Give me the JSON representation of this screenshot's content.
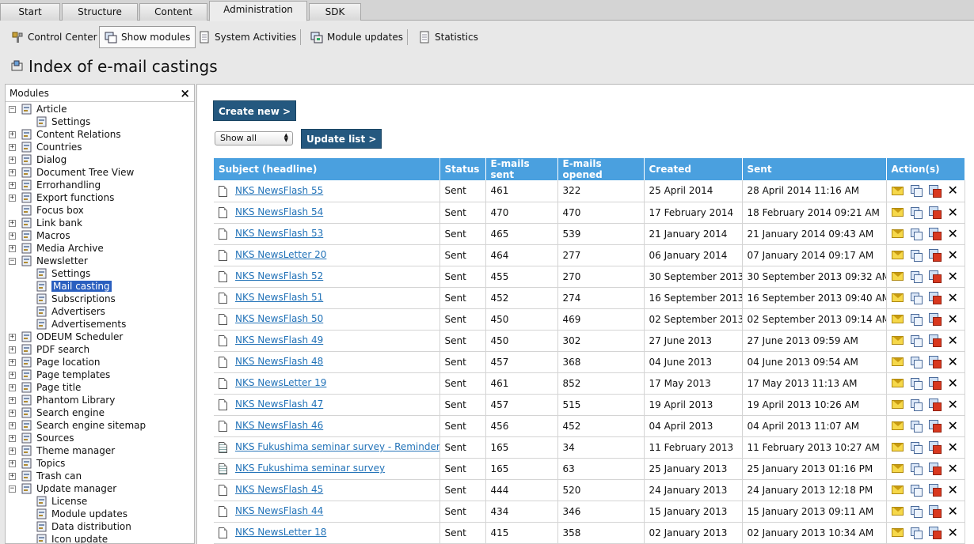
{
  "tabs": [
    "Start",
    "Structure",
    "Content",
    "Administration",
    "SDK"
  ],
  "toolbar": {
    "control_center": "Control Center",
    "show_modules": "Show modules",
    "system_activities": "System Activities",
    "module_updates": "Module updates",
    "statistics": "Statistics"
  },
  "page_title": "Index of e-mail castings",
  "sidebar": {
    "title": "Modules",
    "close": "×",
    "tree": [
      {
        "label": "Article",
        "toggle": "−",
        "level": 0,
        "icon": "article-icon"
      },
      {
        "label": "Settings",
        "toggle": "",
        "level": 1,
        "icon": "settings-icon"
      },
      {
        "label": "Content Relations",
        "toggle": "+",
        "level": 0,
        "icon": "relations-icon"
      },
      {
        "label": "Countries",
        "toggle": "+",
        "level": 0,
        "icon": "globe-icon"
      },
      {
        "label": "Dialog",
        "toggle": "+",
        "level": 0,
        "icon": "dialog-icon"
      },
      {
        "label": "Document Tree View",
        "toggle": "+",
        "level": 0,
        "icon": "tree-view-icon"
      },
      {
        "label": "Errorhandling",
        "toggle": "+",
        "level": 0,
        "icon": "error-icon"
      },
      {
        "label": "Export functions",
        "toggle": "+",
        "level": 0,
        "icon": "export-icon"
      },
      {
        "label": "Focus box",
        "toggle": "",
        "level": 0,
        "icon": "focus-box-icon"
      },
      {
        "label": "Link bank",
        "toggle": "+",
        "level": 0,
        "icon": "link-icon"
      },
      {
        "label": "Macros",
        "toggle": "+",
        "level": 0,
        "icon": "macros-icon"
      },
      {
        "label": "Media Archive",
        "toggle": "+",
        "level": 0,
        "icon": "folder-icon"
      },
      {
        "label": "Newsletter",
        "toggle": "−",
        "level": 0,
        "icon": "newsletter-icon"
      },
      {
        "label": "Settings",
        "toggle": "",
        "level": 1,
        "icon": "settings-icon"
      },
      {
        "label": "Mail casting",
        "toggle": "",
        "level": 1,
        "icon": "mail-casting-icon",
        "selected": true
      },
      {
        "label": "Subscriptions",
        "toggle": "",
        "level": 1,
        "icon": "subscriptions-icon"
      },
      {
        "label": "Advertisers",
        "toggle": "",
        "level": 1,
        "icon": "advertisers-icon"
      },
      {
        "label": "Advertisements",
        "toggle": "",
        "level": 1,
        "icon": "advertisements-icon"
      },
      {
        "label": "ODEUM Scheduler",
        "toggle": "+",
        "level": 0,
        "icon": "scheduler-icon"
      },
      {
        "label": "PDF search",
        "toggle": "+",
        "level": 0,
        "icon": "pdf-search-icon"
      },
      {
        "label": "Page location",
        "toggle": "+",
        "level": 0,
        "icon": "page-location-icon"
      },
      {
        "label": "Page templates",
        "toggle": "+",
        "level": 0,
        "icon": "page-templates-icon"
      },
      {
        "label": "Page title",
        "toggle": "+",
        "level": 0,
        "icon": "page-title-icon"
      },
      {
        "label": "Phantom Library",
        "toggle": "+",
        "level": 0,
        "icon": "library-icon"
      },
      {
        "label": "Search engine",
        "toggle": "+",
        "level": 0,
        "icon": "search-icon"
      },
      {
        "label": "Search engine sitemap",
        "toggle": "+",
        "level": 0,
        "icon": "sitemap-icon"
      },
      {
        "label": "Sources",
        "toggle": "+",
        "level": 0,
        "icon": "sources-icon"
      },
      {
        "label": "Theme manager",
        "toggle": "+",
        "level": 0,
        "icon": "theme-icon"
      },
      {
        "label": "Topics",
        "toggle": "+",
        "level": 0,
        "icon": "topics-icon"
      },
      {
        "label": "Trash can",
        "toggle": "+",
        "level": 0,
        "icon": "trash-icon"
      },
      {
        "label": "Update manager",
        "toggle": "−",
        "level": 0,
        "icon": "update-manager-icon"
      },
      {
        "label": "License",
        "toggle": "",
        "level": 1,
        "icon": "license-icon"
      },
      {
        "label": "Module updates",
        "toggle": "",
        "level": 1,
        "icon": "module-updates-icon"
      },
      {
        "label": "Data distribution",
        "toggle": "",
        "level": 1,
        "icon": "data-distribution-icon"
      },
      {
        "label": "Icon update",
        "toggle": "",
        "level": 1,
        "icon": "icon-update-icon"
      }
    ]
  },
  "main": {
    "create_new": "Create new >",
    "filter_select": "Show all",
    "update_list": "Update list >",
    "columns": [
      "Subject (headline)",
      "Status",
      "E-mails sent",
      "E-mails opened",
      "Created",
      "Sent",
      "Action(s)"
    ],
    "rows": [
      {
        "subject": "NKS NewsFlash 55",
        "status": "Sent",
        "sent_count": "461",
        "opened": "322",
        "created": "25 April 2014",
        "sent": "28 April 2014 11:16 AM",
        "doc": "plain"
      },
      {
        "subject": "NKS NewsFlash 54",
        "status": "Sent",
        "sent_count": "470",
        "opened": "470",
        "created": "17 February 2014",
        "sent": "18 February 2014 09:21 AM",
        "doc": "plain"
      },
      {
        "subject": "NKS NewsFlash 53",
        "status": "Sent",
        "sent_count": "465",
        "opened": "539",
        "created": "21 January 2014",
        "sent": "21 January 2014 09:43 AM",
        "doc": "plain"
      },
      {
        "subject": "NKS NewsLetter 20",
        "status": "Sent",
        "sent_count": "464",
        "opened": "277",
        "created": "06 January 2014",
        "sent": "07 January 2014 09:17 AM",
        "doc": "plain"
      },
      {
        "subject": "NKS NewsFlash 52",
        "status": "Sent",
        "sent_count": "455",
        "opened": "270",
        "created": "30 September 2013",
        "sent": "30 September 2013 09:32 AM",
        "doc": "plain"
      },
      {
        "subject": "NKS NewsFlash 51",
        "status": "Sent",
        "sent_count": "452",
        "opened": "274",
        "created": "16 September 2013",
        "sent": "16 September 2013 09:40 AM",
        "doc": "plain"
      },
      {
        "subject": "NKS NewsFlash 50",
        "status": "Sent",
        "sent_count": "450",
        "opened": "469",
        "created": "02 September 2013",
        "sent": "02 September 2013 09:14 AM",
        "doc": "plain"
      },
      {
        "subject": "NKS NewsFlash 49",
        "status": "Sent",
        "sent_count": "450",
        "opened": "302",
        "created": "27 June 2013",
        "sent": "27 June 2013 09:59 AM",
        "doc": "plain"
      },
      {
        "subject": "NKS NewsFlash 48",
        "status": "Sent",
        "sent_count": "457",
        "opened": "368",
        "created": "04 June 2013",
        "sent": "04 June 2013 09:54 AM",
        "doc": "plain"
      },
      {
        "subject": "NKS NewsLetter 19",
        "status": "Sent",
        "sent_count": "461",
        "opened": "852",
        "created": "17 May 2013",
        "sent": "17 May 2013 11:13 AM",
        "doc": "plain"
      },
      {
        "subject": "NKS NewsFlash 47",
        "status": "Sent",
        "sent_count": "457",
        "opened": "515",
        "created": "19 April 2013",
        "sent": "19 April 2013 10:26 AM",
        "doc": "plain"
      },
      {
        "subject": "NKS NewsFlash 46",
        "status": "Sent",
        "sent_count": "456",
        "opened": "452",
        "created": "04 April 2013",
        "sent": "04 April 2013 11:07 AM",
        "doc": "plain"
      },
      {
        "subject": "NKS Fukushima seminar survey - Reminder",
        "status": "Sent",
        "sent_count": "165",
        "opened": "34",
        "created": "11 February 2013",
        "sent": "11 February 2013 10:27 AM",
        "doc": "lined"
      },
      {
        "subject": "NKS Fukushima seminar survey",
        "status": "Sent",
        "sent_count": "165",
        "opened": "63",
        "created": "25 January 2013",
        "sent": "25 January 2013 01:16 PM",
        "doc": "lined"
      },
      {
        "subject": "NKS NewsFlash 45",
        "status": "Sent",
        "sent_count": "444",
        "opened": "520",
        "created": "24 January 2013",
        "sent": "24 January 2013 12:18 PM",
        "doc": "plain"
      },
      {
        "subject": "NKS NewsFlash 44",
        "status": "Sent",
        "sent_count": "434",
        "opened": "346",
        "created": "15 January 2013",
        "sent": "15 January 2013 09:11 AM",
        "doc": "plain"
      },
      {
        "subject": "NKS NewsLetter 18",
        "status": "Sent",
        "sent_count": "415",
        "opened": "358",
        "created": "02 January 2013",
        "sent": "02 January 2013 10:34 AM",
        "doc": "plain"
      }
    ]
  }
}
